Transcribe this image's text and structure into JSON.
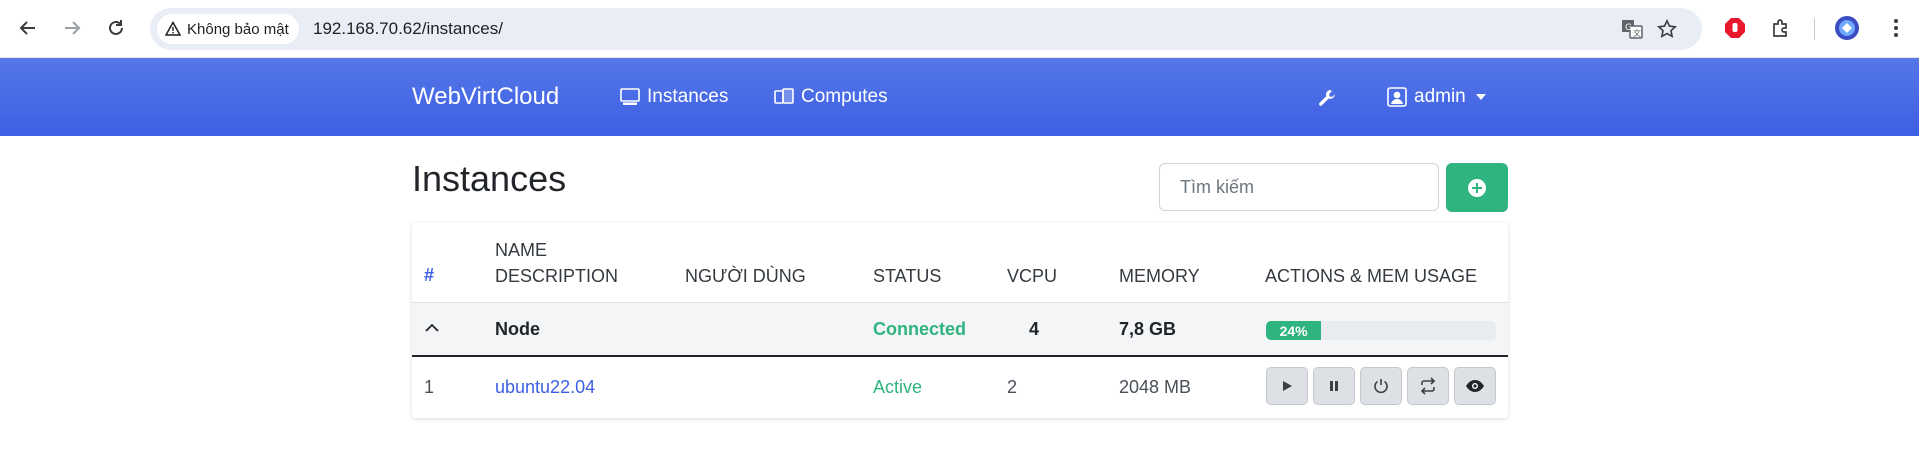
{
  "browser": {
    "security_label": "Không bảo mật",
    "url": "192.168.70.62/instances/"
  },
  "navbar": {
    "brand": "WebVirtCloud",
    "links": [
      {
        "label": "Instances",
        "icon": "monitor-icon"
      },
      {
        "label": "Computes",
        "icon": "server-icon"
      }
    ],
    "settings_icon": "wrench-icon",
    "user": {
      "label": "admin",
      "icon": "user-icon"
    }
  },
  "page": {
    "title": "Instances",
    "search_placeholder": "Tìm kiếm",
    "add_icon": "plus-circle-icon"
  },
  "table": {
    "headers": {
      "hash": "#",
      "name": "NAME",
      "description": "DESCRIPTION",
      "user": "NGƯỜI DÙNG",
      "status": "STATUS",
      "vcpu": "VCPU",
      "memory": "MEMORY",
      "actions": "ACTIONS & MEM USAGE"
    },
    "node": {
      "name": "Node",
      "status": "Connected",
      "vcpu": "4",
      "memory": "7,8 GB",
      "mem_usage_label": "24%",
      "mem_usage_percent": 24
    },
    "instances": [
      {
        "index": "1",
        "name": "ubuntu22.04",
        "status": "Active",
        "vcpu": "2",
        "memory": "2048 MB",
        "actions": [
          "play-icon",
          "pause-icon",
          "power-icon",
          "refresh-icon",
          "eye-icon"
        ]
      }
    ]
  },
  "colors": {
    "navbar": "#4468e6",
    "accent_blue": "#3d5fe3",
    "success_green": "#2fb37f"
  }
}
